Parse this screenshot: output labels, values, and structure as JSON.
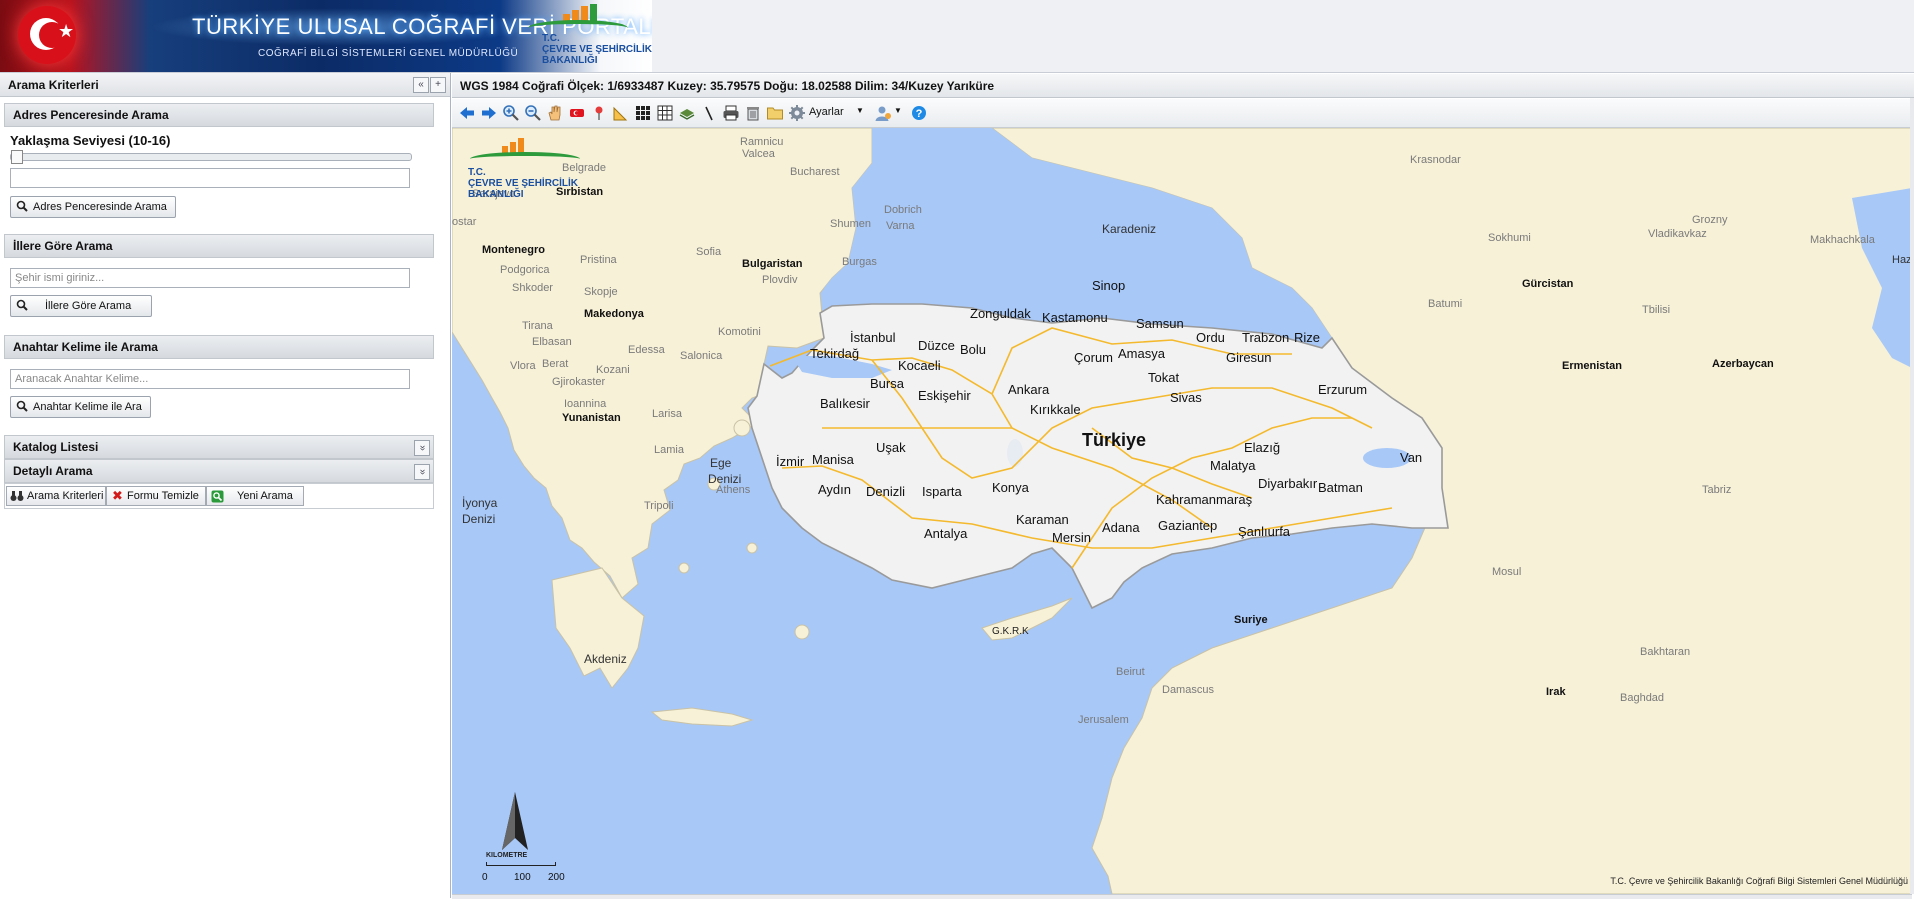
{
  "banner": {
    "title": "TÜRKİYE ULUSAL COĞRAFİ VERİ PORTALI",
    "subtitle": "COĞRAFİ BİLGİ SİSTEMLERİ GENEL MÜDÜRLÜĞÜ",
    "logo_line1": "T.C.",
    "logo_line2": "ÇEVRE VE ŞEHİRCİLİK",
    "logo_line3": "BAKANLIĞI"
  },
  "left_panel": {
    "title": "Arama Kriterleri",
    "collapse_glyph": "«",
    "expand_glyph": "+",
    "address": {
      "header": "Adres Penceresinde Arama",
      "zoom_label": "Yaklaşma Seviyesi (10-16)",
      "zoom_level": 0,
      "input_value": "",
      "button": "Adres Penceresinde Arama"
    },
    "province": {
      "header": "İllere Göre Arama",
      "placeholder": "Şehir ismi giriniz...",
      "button": "İllere Göre Arama"
    },
    "keyword": {
      "header": "Anahtar Kelime ile Arama",
      "placeholder": "Aranacak Anahtar Kelime...",
      "button": "Anahtar Kelime ile Ara"
    },
    "catalog": {
      "header": "Katalog Listesi",
      "glyph": "»"
    },
    "detailed": {
      "header": "Detaylı Arama",
      "glyph": "»"
    },
    "bottom_buttons": [
      "Arama Kriterleri",
      "Formu Temizle",
      "Yeni Arama"
    ]
  },
  "status_bar": {
    "text": "WGS 1984 Coğrafi Ölçek: 1/6933487 Kuzey: 35.79575 Doğu: 18.02588 Dilim: 34/Kuzey Yarıküre"
  },
  "toolbar": {
    "settings_label": "Ayarlar",
    "tools": [
      "back-arrow-icon",
      "forward-arrow-icon",
      "zoom-in-icon",
      "zoom-out-icon",
      "pan-hand-icon",
      "flag-icon",
      "pin-icon",
      "measure-icon",
      "grid-large-icon",
      "grid-small-icon",
      "layers-icon",
      "draw-line-icon",
      "print-icon",
      "delete-icon",
      "folder-icon",
      "gear-icon",
      "user-icon",
      "help-icon"
    ]
  },
  "map": {
    "colors": {
      "sea": "#a8c8f7",
      "land": "#f7f1d8",
      "turkey": "#f2f2f2",
      "road": "#f4b92c",
      "border": "#9a9a9a"
    },
    "logo_line1": "T.C.",
    "logo_line2": "ÇEVRE VE ŞEHİRCİLİK",
    "logo_line3": "BAKANLIĞI",
    "north_label": "KILOMETRE",
    "scale_ticks": [
      "0",
      "100",
      "200"
    ],
    "credit": "T.C. Çevre ve Şehircilik Bakanlığı Coğrafi Bilgi Sistemleri Genel Müdürlüğü",
    "labels": {
      "ramnicu": "Ramnicu",
      "valcea": "Valcea",
      "belgrade": "Belgrade",
      "sirbistan": "Sırbistan",
      "sarajevo": "Sarajevo",
      "ostar": "ostar",
      "montenegro": "Montenegro",
      "pristina": "Pristina",
      "podgorica": "Podgorica",
      "shkoder": "Shkoder",
      "skopje": "Skopje",
      "makedonya": "Makedonya",
      "tirana": "Tirana",
      "elbasan": "Elbasan",
      "berat": "Berat",
      "vlora": "Vlora",
      "gjirokaster": "Gjirokaster",
      "ioannina": "Ioannina",
      "yunanistan": "Yunanistan",
      "edessa": "Edessa",
      "kozani": "Kozani",
      "salonica": "Salonica",
      "larisa": "Larisa",
      "lamia": "Lamia",
      "athens": "Athens",
      "tripoli": "Tripoli",
      "bucharest": "Bucharest",
      "sofia": "Sofia",
      "bulgaristan": "Bulgaristan",
      "plovdiv": "Plovdiv",
      "burgas": "Burgas",
      "shumen": "Shumen",
      "dobrich": "Dobrich",
      "varna": "Varna",
      "komotini": "Komotini",
      "krasnodar": "Krasnodar",
      "karadeniz": "Karadeniz",
      "grozny": "Grozny",
      "sokhumi": "Sokhumi",
      "vladikavkaz": "Vladikavkaz",
      "makhachkala": "Makhachkala",
      "gurcistan": "Gürcistan",
      "batumi": "Batumi",
      "tbilisi": "Tbilisi",
      "haz": "Haz",
      "ermenistan": "Ermenistan",
      "azerbaycan": "Azerbaycan",
      "tabriz": "Tabriz",
      "mosul": "Mosul",
      "suriye": "Suriye",
      "irak": "Irak",
      "baghdad": "Baghdad",
      "bakhtaran": "Bakhtaran",
      "beirut": "Beirut",
      "damascus": "Damascus",
      "jerusalem": "Jerusalem",
      "akdeniz": "Akdeniz",
      "iyonya": "İyonya",
      "denizi": "Denizi",
      "ege": "Ege",
      "ege_denizi": "Denizi",
      "gkrk": "G.K.R.K",
      "sinop": "Sinop",
      "zonguldak": "Zonguldak",
      "kastamonu": "Kastamonu",
      "samsun": "Samsun",
      "ordu": "Ordu",
      "trabzon": "Trabzon",
      "rize": "Rize",
      "istanbul": "İstanbul",
      "tekirdag": "Tekirdağ",
      "duzce": "Düzce",
      "bolu": "Bolu",
      "kocaeli": "Kocaeli",
      "corum": "Çorum",
      "amasya": "Amasya",
      "giresun": "Giresun",
      "tokat": "Tokat",
      "bursa": "Bursa",
      "ankara": "Ankara",
      "erzurum": "Erzurum",
      "balikesir": "Balıkesir",
      "eskisehir": "Eskişehir",
      "kirikkale": "Kırıkkale",
      "sivas": "Sivas",
      "turkiye": "Türkiye",
      "usak": "Uşak",
      "elazig": "Elazığ",
      "izmir": "İzmir",
      "manisa": "Manisa",
      "van": "Van",
      "malatya": "Malatya",
      "aydin": "Aydın",
      "denizli": "Denizli",
      "isparta": "Isparta",
      "konya": "Konya",
      "diyarbakir": "Diyarbakır",
      "batman": "Batman",
      "kahramanmaras": "Kahramanmaraş",
      "karaman": "Karaman",
      "adana": "Adana",
      "gaziantep": "Gaziantep",
      "mersin": "Mersin",
      "antalya": "Antalya",
      "sanliurfa": "Şanlıurfa"
    }
  }
}
